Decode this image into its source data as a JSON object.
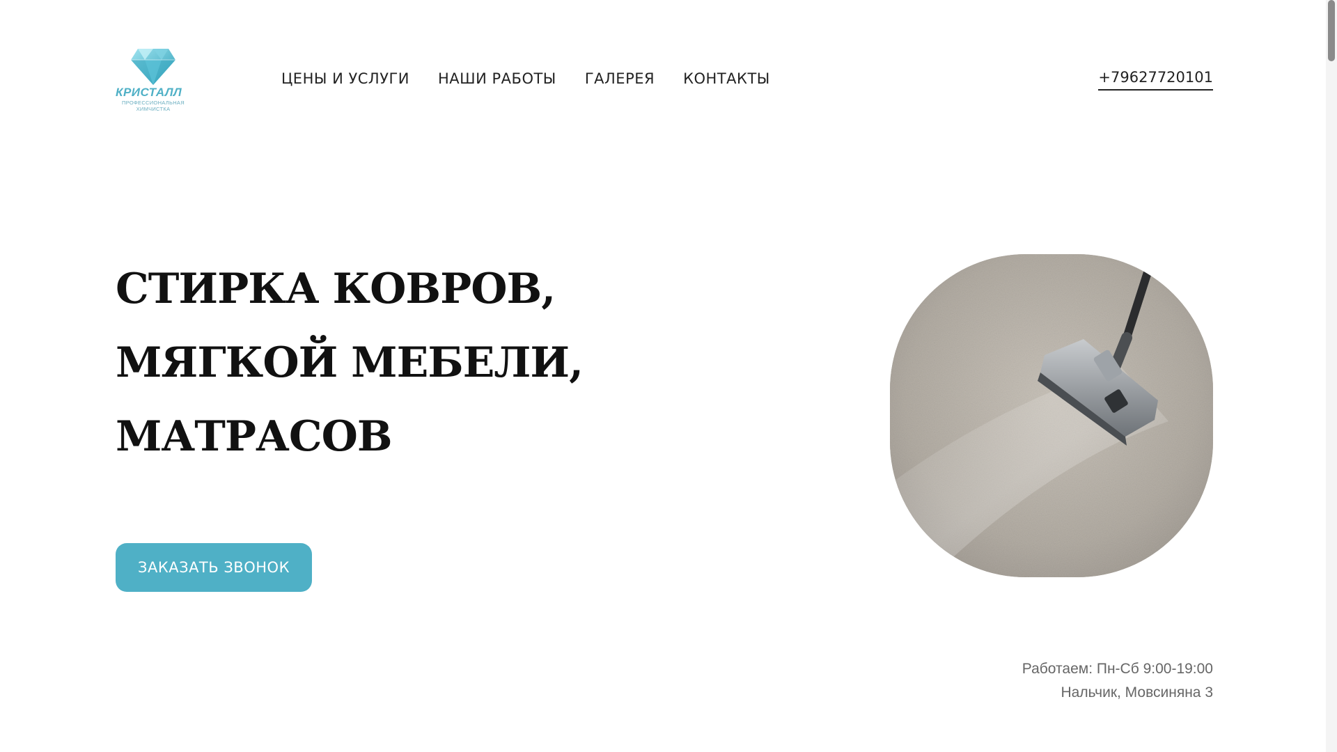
{
  "logo": {
    "name": "КРИСТАЛЛ",
    "sub1": "ПРОФЕССИОНАЛЬНАЯ",
    "sub2": "ХИМЧИСТКА",
    "icon": "diamond-icon"
  },
  "nav": {
    "items": [
      {
        "label": "ЦЕНЫ И УСЛУГИ"
      },
      {
        "label": "НАШИ РАБОТЫ"
      },
      {
        "label": "ГАЛЕРЕЯ"
      },
      {
        "label": "КОНТАКТЫ"
      }
    ]
  },
  "header": {
    "phone": "+79627720101"
  },
  "hero": {
    "headline": [
      "СТИРКА КОВРОВ,",
      "МЯГКОЙ МЕБЕЛИ,",
      "МАТРАСОВ"
    ],
    "cta_label": "ЗАКАЗАТЬ ЗВОНОК",
    "image": "carpet-vacuum-photo"
  },
  "info": {
    "hours": "Работаем: Пн-Сб 9:00-19:00",
    "address": "Нальчик, Мовсиняна 3"
  },
  "colors": {
    "accent": "#4fb0c6",
    "text": "#1a1a1a",
    "muted": "#666666"
  }
}
